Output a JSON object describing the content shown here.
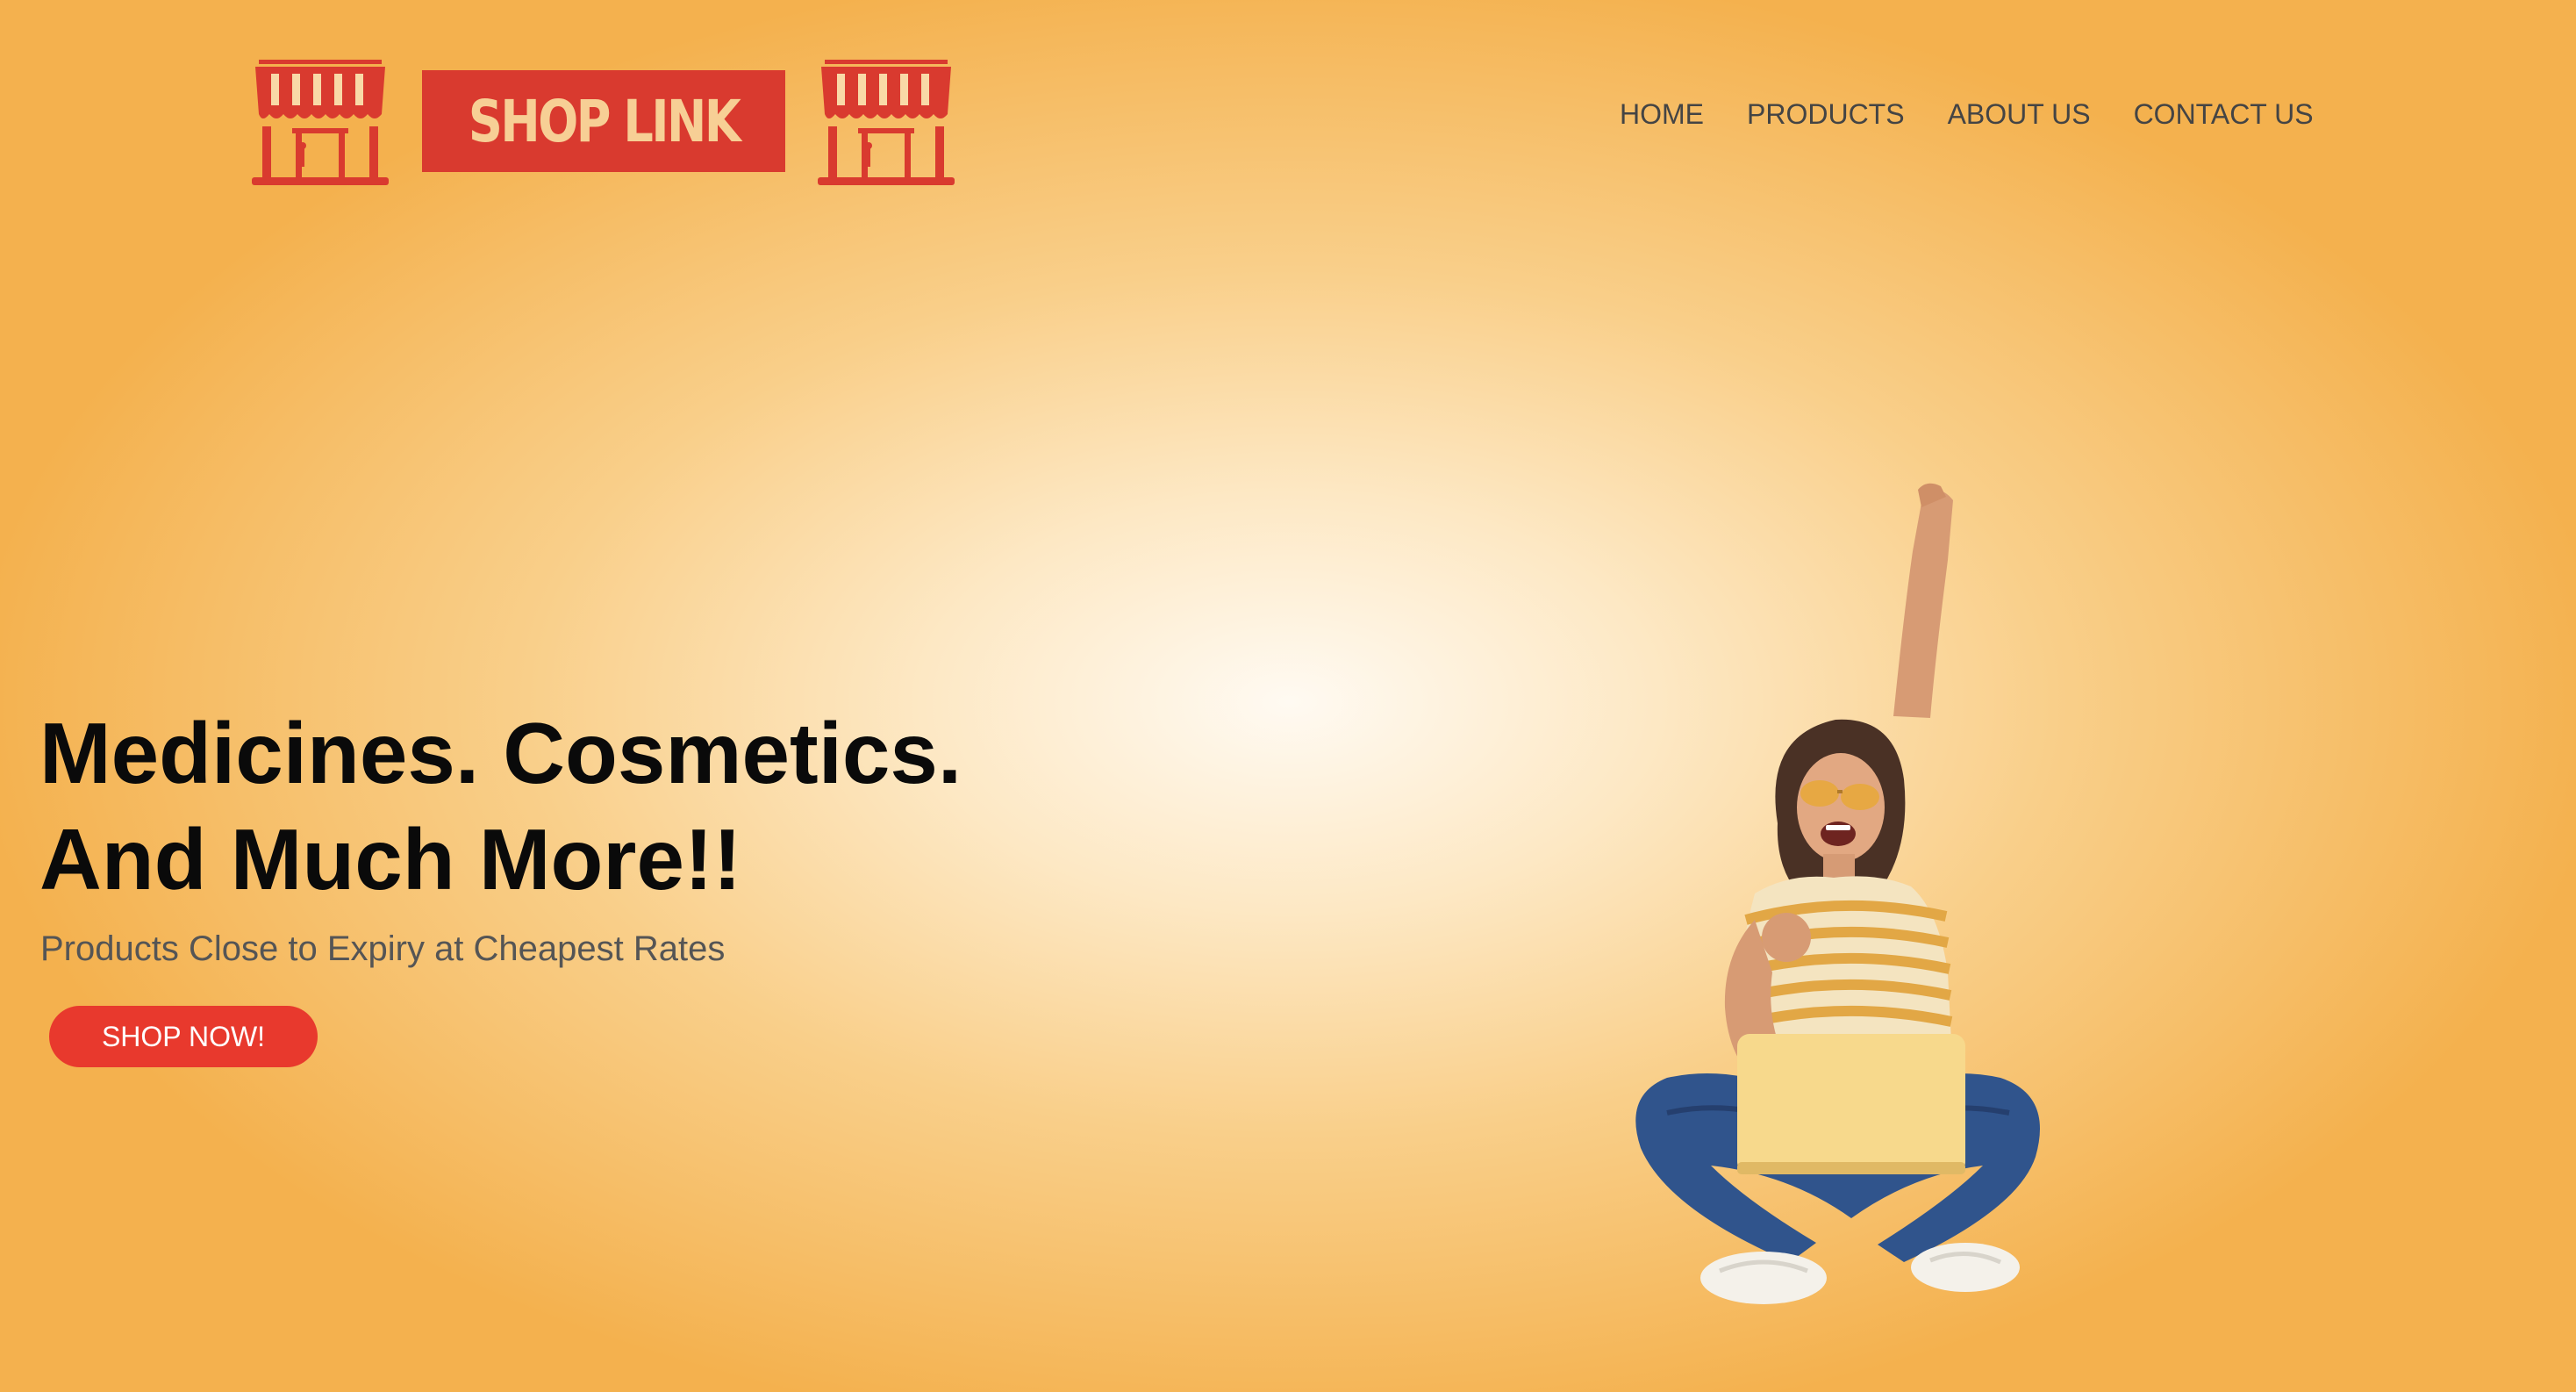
{
  "brand": {
    "name": "SHOP LINK",
    "icon_left": "storefront-icon",
    "icon_right": "storefront-icon",
    "colors": {
      "primary_red": "#d93a2f",
      "logo_text": "#f7cf95"
    }
  },
  "nav": {
    "items": [
      {
        "label": "HOME"
      },
      {
        "label": "PRODUCTS"
      },
      {
        "label": "ABOUT US"
      },
      {
        "label": "CONTACT US"
      }
    ]
  },
  "hero": {
    "title_line1": "Medicines. Cosmetics.",
    "title_line2": "And Much More!!",
    "subtitle": "Products Close to Expiry at Cheapest Rates",
    "cta_label": "SHOP NOW!",
    "cta_color": "#e8392d",
    "image_subject": "celebrating-woman-with-laptop"
  },
  "theme": {
    "background_center": "#fffaf2",
    "background_edge": "#f4b14e"
  }
}
